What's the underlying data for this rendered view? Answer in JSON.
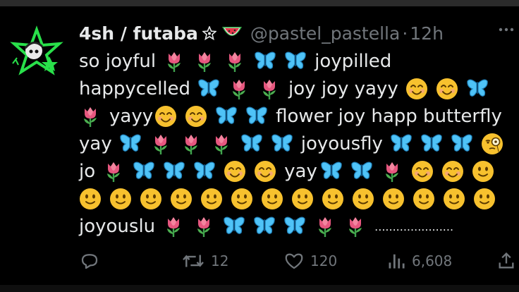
{
  "header": {
    "display_name": "4sh / futaba",
    "handle": "@pastel_pastella",
    "separator": "·",
    "time": "12h",
    "name_icons": [
      "star-badge-icon",
      "watermelon-icon"
    ]
  },
  "tweet": {
    "line1": {
      "t1": "so joyful",
      "t2": "joypilled"
    },
    "line2": {
      "t1": "happycelled",
      "t2": "joy joy yayy"
    },
    "line3": {
      "t1": "yayy",
      "t2": "flower joy happ butterfly"
    },
    "line4": {
      "t1": "yay",
      "t2": "joyousfly"
    },
    "line5": {
      "t1": "jo",
      "t2": "yay"
    },
    "line7": {
      "t1": "joyouslu",
      "t2": "......................"
    },
    "emoji_names": {
      "tulip": "tulip-icon",
      "butterfly": "butterfly-icon",
      "smile": "smiling-face-icon",
      "slight": "slightly-smiling-face-icon",
      "monocle": "monocle-face-icon"
    }
  },
  "actions": {
    "retweets": "12",
    "likes": "120",
    "views": "6,608"
  },
  "colors": {
    "background": "#000000",
    "text": "#e7e9ea",
    "muted": "#71767b",
    "tulip": "#e6577f",
    "butterfly": "#4fc3f7",
    "face": "#f7c12e",
    "avatar_green": "#29e04a"
  }
}
